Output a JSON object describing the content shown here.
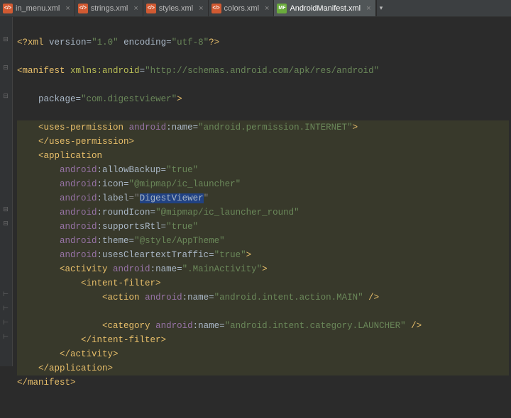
{
  "tabs": [
    {
      "label": "in_menu.xml",
      "icon": "xml",
      "active": false
    },
    {
      "label": "strings.xml",
      "icon": "xml",
      "active": false
    },
    {
      "label": "styles.xml",
      "icon": "xml",
      "active": false
    },
    {
      "label": "colors.xml",
      "icon": "xml",
      "active": false
    },
    {
      "label": "AndroidManifest.xml",
      "icon": "mf",
      "active": true
    }
  ],
  "icon_text": {
    "xml": "</>",
    "mf": "MF"
  },
  "close_glyph": "×",
  "chevron_glyph": "▾",
  "xml_decl": {
    "open": "<?xml",
    "v_attr": "version",
    "v_val": "\"1.0\"",
    "e_attr": "encoding",
    "e_val": "\"utf-8\"",
    "close": "?>"
  },
  "manifest": {
    "open": "<manifest",
    "xmlns_attr": "xmlns:android",
    "xmlns_val": "\"http://schemas.android.com/apk/res/android\"",
    "pkg_attr": "package",
    "pkg_val": "\"com.digestviewer\"",
    "close_tag": ">",
    "end": "</manifest>"
  },
  "uses_perm": {
    "open": "<uses-permission",
    "name_ns": "android",
    "name_attr": "name",
    "name_val": "\"android.permission.INTERNET\"",
    "end_open": ">",
    "end": "</uses-permission>"
  },
  "app": {
    "open": "<application",
    "allow_ns": "android",
    "allow_attr": ":allowBackup",
    "allow_eq": "=",
    "allow_val": "\"true\"",
    "icon_ns": "android",
    "icon_attr": ":icon",
    "icon_eq": "=",
    "icon_val": "\"@mipmap/ic_launcher\"",
    "label_ns": "android",
    "label_attr": ":label",
    "label_eq": "=",
    "label_val_open": "\"",
    "label_val_text": "DigestViewer",
    "label_val_close": "\"",
    "round_ns": "android",
    "round_attr": ":roundIcon",
    "round_eq": "=",
    "round_val": "\"@mipmap/ic_launcher_round\"",
    "rtl_ns": "android",
    "rtl_attr": ":supportsRtl",
    "rtl_eq": "=",
    "rtl_val": "\"true\"",
    "theme_ns": "android",
    "theme_attr": ":theme",
    "theme_eq": "=",
    "theme_val": "\"@style/AppTheme\"",
    "clr_ns": "android",
    "clr_attr": ":usesCleartextTraffic",
    "clr_eq": "=",
    "clr_val": "\"true\"",
    "close": ">",
    "end": "</application>"
  },
  "activity": {
    "open": "<activity",
    "name_ns": "android",
    "name_attr": ":name",
    "name_eq": "=",
    "name_val": "\".MainActivity\"",
    "close": ">",
    "end": "</activity>"
  },
  "intent": {
    "open": "<intent-filter>",
    "end": "</intent-filter>",
    "action_open": "<action",
    "action_ns": "android",
    "action_attr": ":name",
    "action_eq": "=",
    "action_val": "\"android.intent.action.MAIN\"",
    "action_close": " />",
    "cat_open": "<category",
    "cat_ns": "android",
    "cat_attr": ":name",
    "cat_eq": "=",
    "cat_val": "\"android.intent.category.LAUNCHER\"",
    "cat_close": " />"
  },
  "indent": {
    "i1": "    ",
    "i2": "        ",
    "i3": "            ",
    "i4": "                ",
    "i5": "                    "
  }
}
